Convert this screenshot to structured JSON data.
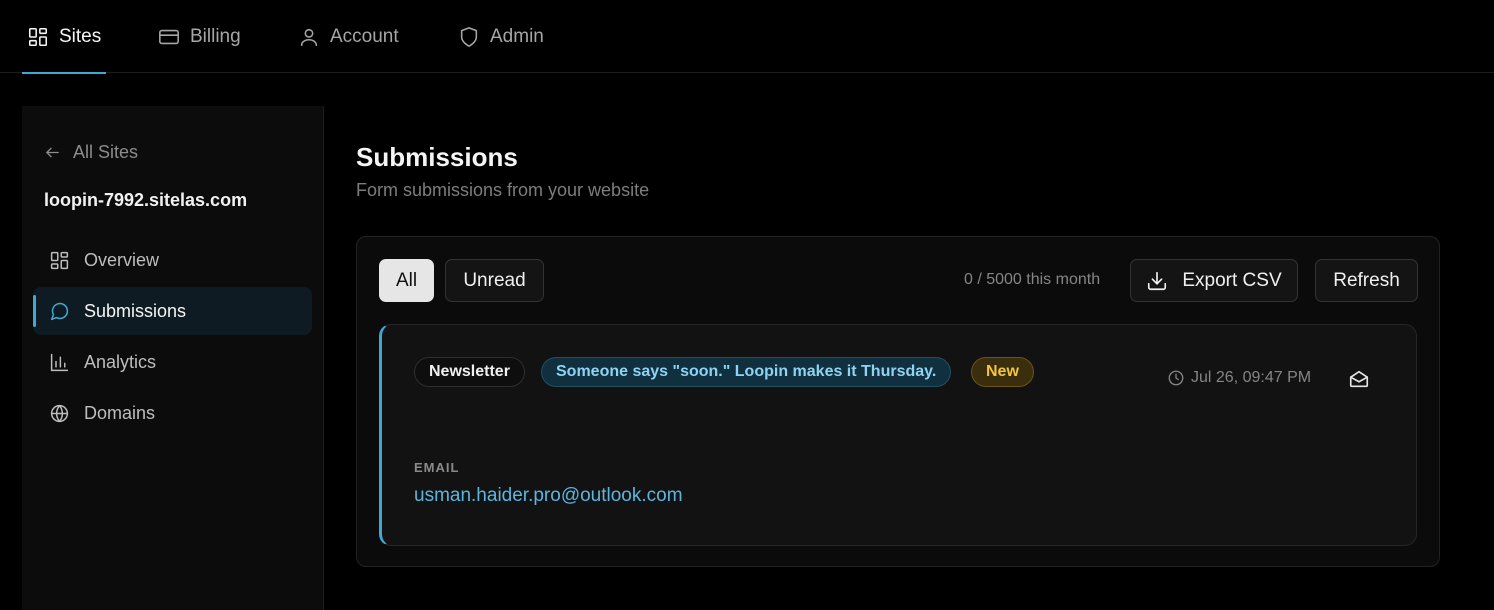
{
  "topnav": {
    "tabs": [
      {
        "label": "Sites",
        "icon": "grid-icon",
        "active": true
      },
      {
        "label": "Billing",
        "icon": "card-icon",
        "active": false
      },
      {
        "label": "Account",
        "icon": "user-icon",
        "active": false
      },
      {
        "label": "Admin",
        "icon": "shield-icon",
        "active": false
      }
    ]
  },
  "sidebar": {
    "back_label": "All Sites",
    "site_name": "loopin-7992.sitelas.com",
    "items": [
      {
        "label": "Overview",
        "icon": "grid-icon",
        "active": false
      },
      {
        "label": "Submissions",
        "icon": "chat-bubble-icon",
        "active": true
      },
      {
        "label": "Analytics",
        "icon": "bar-chart-icon",
        "active": false
      },
      {
        "label": "Domains",
        "icon": "globe-icon",
        "active": false
      }
    ]
  },
  "main": {
    "title": "Submissions",
    "subtitle": "Form submissions from your website",
    "filters": {
      "all": "All",
      "unread": "Unread"
    },
    "quota": "0 / 5000 this month",
    "export_label": "Export CSV",
    "refresh_label": "Refresh",
    "submission": {
      "form_name": "Newsletter",
      "page_tag": "Someone says \"soon.\" Loopin makes it Thursday.",
      "status": "New",
      "timestamp": "Jul 26, 09:47 PM",
      "field_label": "EMAIL",
      "field_value": "usman.haider.pro@outlook.com"
    }
  },
  "colors": {
    "accent": "#3fa9d6",
    "new_badge": "#f2c641",
    "link": "#5ab6df"
  }
}
